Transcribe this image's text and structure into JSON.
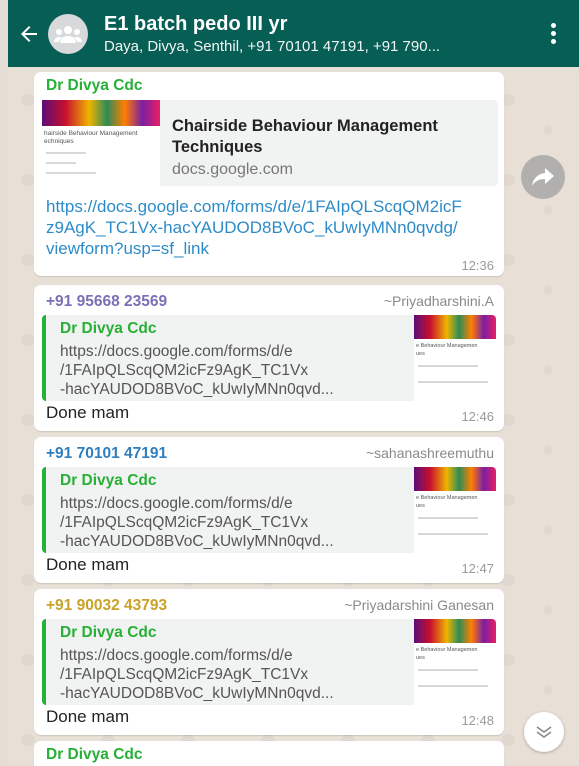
{
  "header": {
    "title": "E1 batch pedo III yr",
    "subtitle": "Daya, Divya, Senthil, +91 70101 47191, +91 790..."
  },
  "messages": [
    {
      "sender": "Dr Divya Cdc",
      "preview_title": "Chairside Behaviour Management Techniques",
      "preview_domain": "docs.google.com",
      "thumb_caption": "hairside Behaviour Management\nechniques",
      "link": "https://docs.google.com/forms/d/e/1FAIpQLScqQM2icFz9AgK_TC1Vx-hacYAUDOD8BVoC_kUwIyMNn0qvdg/viewform?usp=sf_link",
      "time": "12:36"
    },
    {
      "phone": "+91 95668 23569",
      "alias": "~Priyadharshini.A",
      "phone_color": "#7b6fb5",
      "quote_sender": "Dr Divya Cdc",
      "quote_lines": [
        "https://docs.google.com/forms/d/e",
        "/1FAIpQLScqQM2icFz9AgK_TC1Vx",
        "-hacYAUDOD8BVoC_kUwIyMNn0qvd..."
      ],
      "thumb_caption": "e Behaviour Managemen\nues",
      "text": "Done mam",
      "time": "12:46"
    },
    {
      "phone": "+91 70101 47191",
      "alias": "~sahanashreemuthu",
      "phone_color": "#2f7fbf",
      "quote_sender": "Dr Divya Cdc",
      "quote_lines": [
        "https://docs.google.com/forms/d/e",
        "/1FAIpQLScqQM2icFz9AgK_TC1Vx",
        "-hacYAUDOD8BVoC_kUwIyMNn0qvd..."
      ],
      "thumb_caption": "e Behaviour Managemen\nues",
      "text": "Done mam",
      "time": "12:47"
    },
    {
      "phone": "+91 90032 43793",
      "alias": "~Priyadarshini Ganesan",
      "phone_color": "#c9a227",
      "quote_sender": "Dr Divya Cdc",
      "quote_lines": [
        "https://docs.google.com/forms/d/e",
        "/1FAIpQLScqQM2icFz9AgK_TC1Vx",
        "-hacYAUDOD8BVoC_kUwIyMNn0qvd..."
      ],
      "thumb_caption": "e Behaviour Managemen\nues",
      "text": "Done mam",
      "time": "12:48"
    },
    {
      "sender": "Dr Divya Cdc"
    }
  ],
  "icons": {
    "back": "arrow-left-icon",
    "avatar": "group-avatar-icon",
    "menu": "more-vertical-icon",
    "forward": "forward-icon",
    "scroll": "chevrons-down-icon"
  },
  "colors": {
    "header": "#075e54",
    "sender_green": "#27b036",
    "link": "#2d8cc8"
  }
}
